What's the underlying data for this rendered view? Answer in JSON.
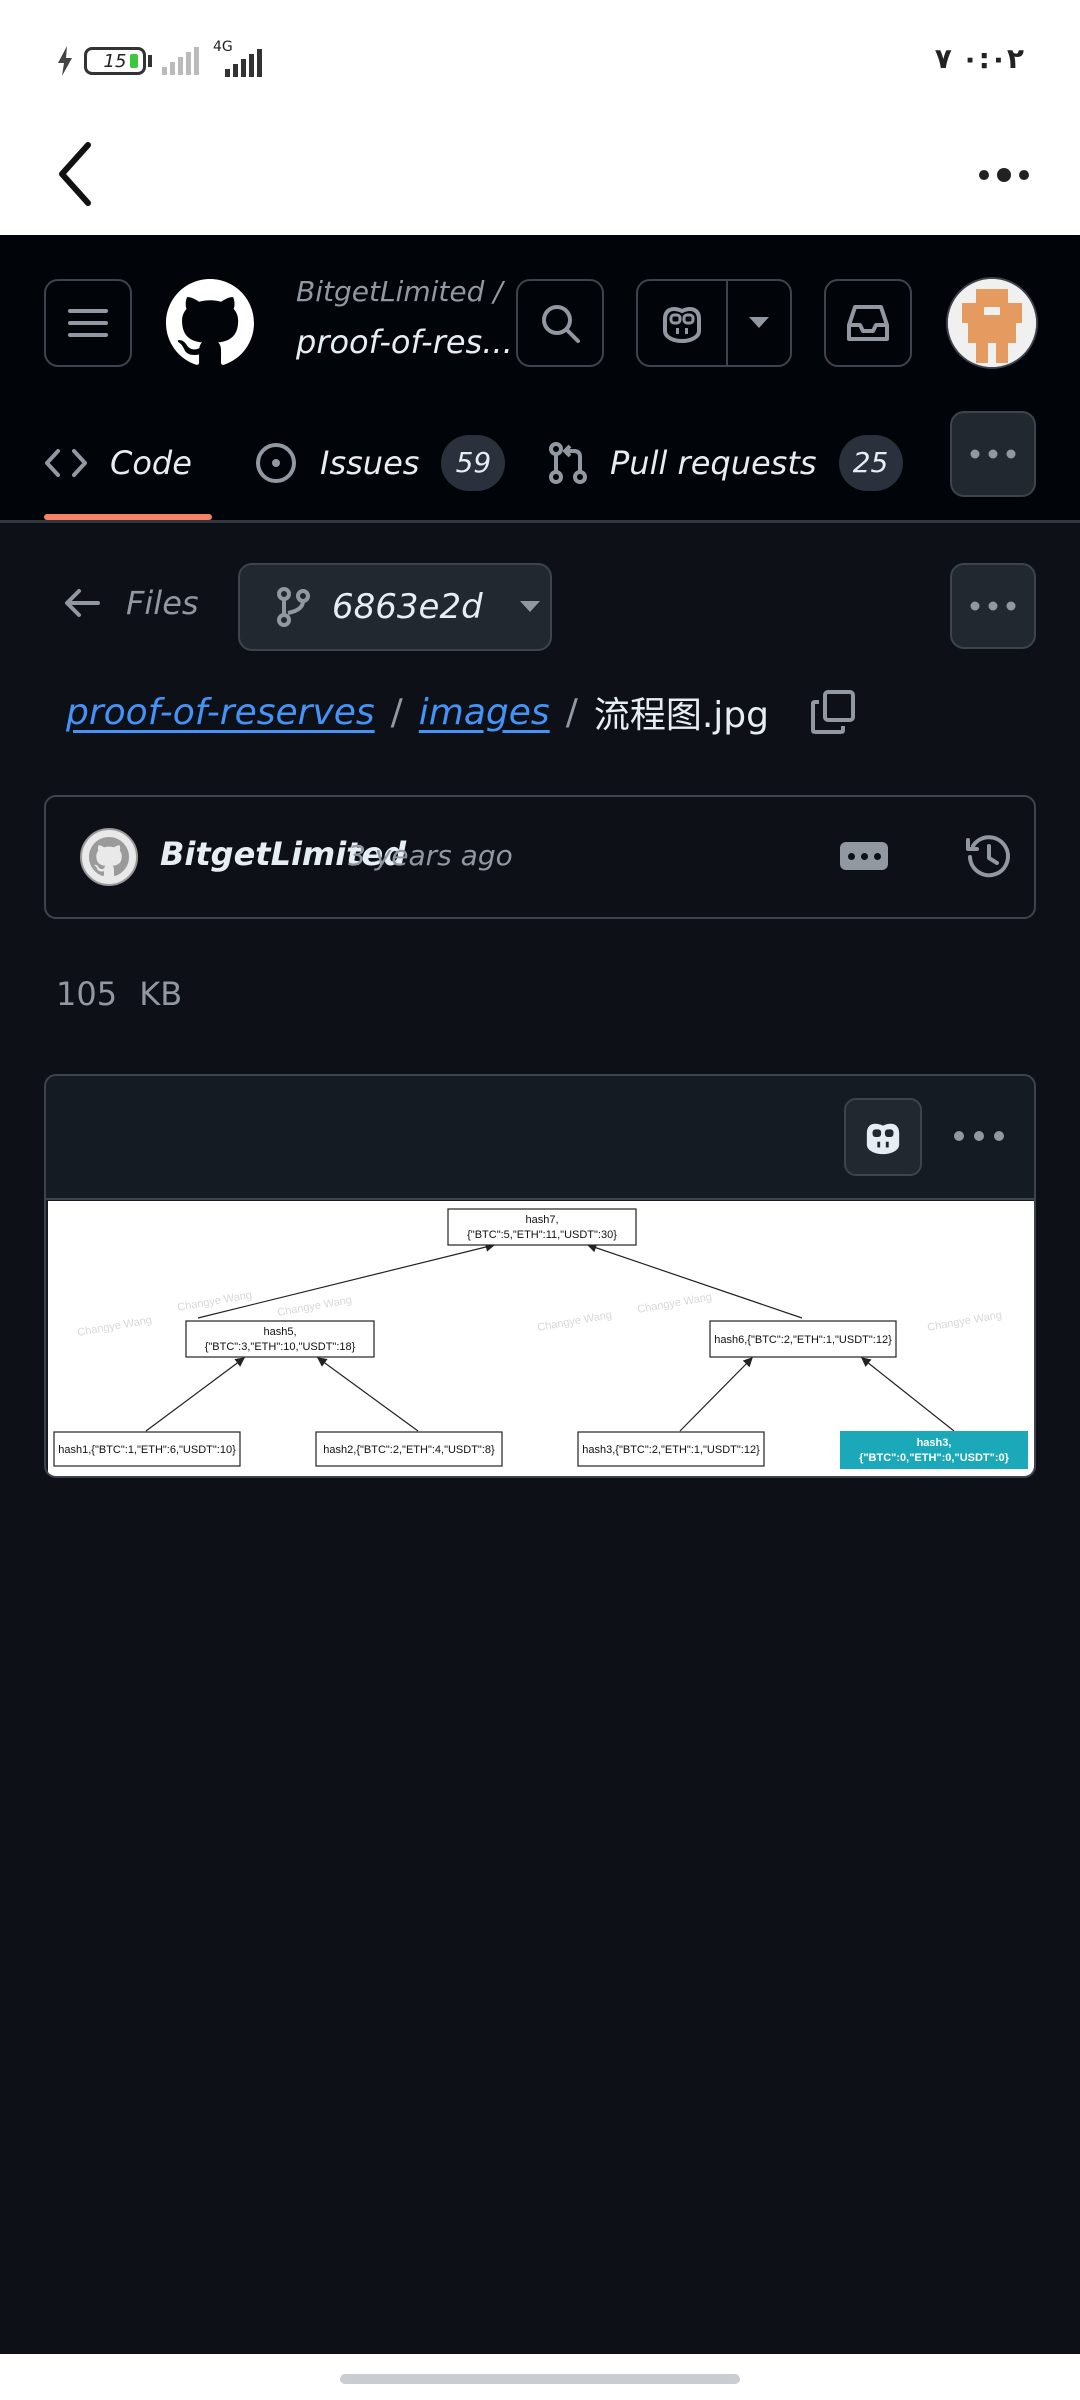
{
  "status_bar": {
    "battery_level": "15",
    "network_type": "4G",
    "time": "٠:٠٢ ٧"
  },
  "repo": {
    "owner": "BitgetLimited /",
    "name": "proof-of-res..."
  },
  "tabs": [
    {
      "label": "Code"
    },
    {
      "label": "Issues",
      "count": "59"
    },
    {
      "label": "Pull requests",
      "count": "25"
    }
  ],
  "files_nav": {
    "back_label": "Files",
    "branch": "6863e2d"
  },
  "breadcrumb": {
    "repo": "proof-of-reserves",
    "folder": "images",
    "file": "流程图.jpg",
    "sep": "/"
  },
  "commit": {
    "author": "BitgetLimited",
    "time": "3 years ago"
  },
  "file_size": "105  KB",
  "diagram": {
    "root": {
      "line1": "hash7,",
      "line2": "{\"BTC\":5,\"ETH\":11,\"USDT\":30}"
    },
    "mid_left": {
      "line1": "hash5,",
      "line2": "{\"BTC\":3,\"ETH\":10,\"USDT\":18}"
    },
    "mid_right": {
      "line1": "hash6,{\"BTC\":2,\"ETH\":1,\"USDT\":12}"
    },
    "leaves": [
      {
        "line1": "hash1,{\"BTC\":1,\"ETH\":6,\"USDT\":10}"
      },
      {
        "line1": "hash2,{\"BTC\":2,\"ETH\":4,\"USDT\":8}"
      },
      {
        "line1": "hash3,{\"BTC\":2,\"ETH\":1,\"USDT\":12}"
      },
      {
        "line1": "hash3,",
        "line2": "{\"BTC\":0,\"ETH\":0,\"USDT\":0}"
      }
    ],
    "highlight_color": "#1ba8b8",
    "watermark": "Changye Wang"
  },
  "colors": {
    "background": "#0d1117",
    "header": "#010409",
    "link": "#4493f8",
    "accent_underline": "#f78166"
  }
}
